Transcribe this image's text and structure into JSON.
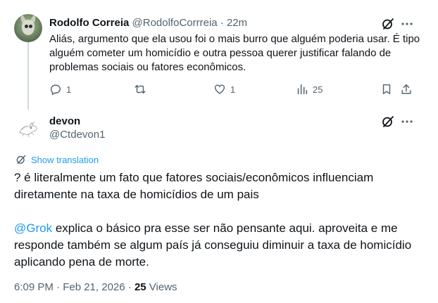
{
  "reply": {
    "author_name": "Rodolfo Correia",
    "author_handle": "@RodolfoCorrreia",
    "separator": "·",
    "time": "22m",
    "text": "Aliás, argumento que ela usou foi o mais burro que alguém poderia usar. É tipo alguém cometer um homicídio e outra pessoa querer justificar falando de problemas sociais ou fatores econômicos.",
    "actions": {
      "reply_count": "1",
      "repost_count": "",
      "like_count": "1",
      "views_count": "25"
    }
  },
  "main_tweet": {
    "author_name": "devon",
    "author_handle": "@Ctdevon1",
    "show_translation": "Show translation",
    "paragraph_1": "? é literalmente um fato que fatores sociais/econômicos influenciam diretamente na taxa de homicídios de um pais",
    "mention": "@Grok",
    "paragraph_2_rest": " explica o básico pra esse ser não pensante aqui. aproveita e me responde também se algum país já conseguiu diminuir a taxa de homicídio aplicando pena de morte.",
    "timestamp": "6:09 PM · Feb 21, 2026 · ",
    "views_count": "25",
    "views_label": " Views"
  },
  "colors": {
    "text_primary": "#0f1419",
    "text_secondary": "#536471",
    "accent": "#1d9bf0",
    "thread_line": "#cfd9de"
  },
  "icons": [
    "grok-icon",
    "more-icon",
    "reply-icon",
    "repost-icon",
    "like-icon",
    "views-icon",
    "bookmark-icon",
    "share-icon",
    "translate-icon"
  ]
}
